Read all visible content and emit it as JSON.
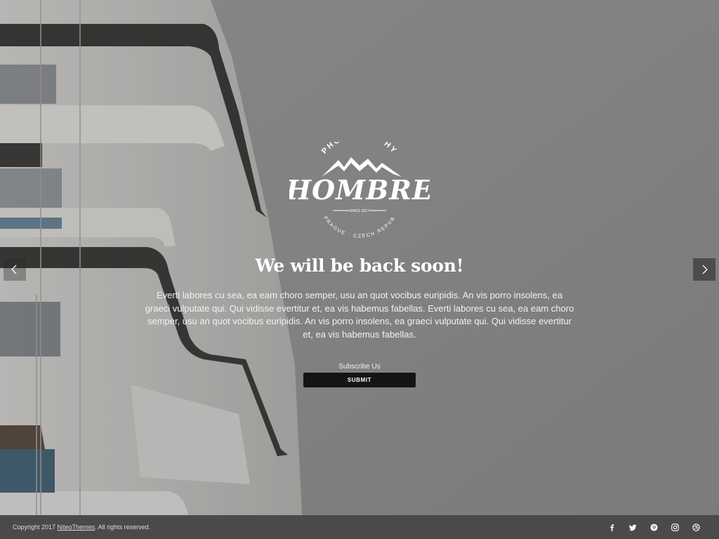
{
  "brand": {
    "top_text": "PHOTOGRAPHY",
    "name": "HOMBRE",
    "since": "SINCE 2017",
    "location": "PRAGUE · CZECH REPUB"
  },
  "hero": {
    "title": "We will be back soon!",
    "description": "Everti labores cu sea, ea eam choro semper, usu an quot vocibus euripidis. An vis porro insolens, ea graeci vulputate qui. Qui vidisse evertitur et, ea vis habemus fabellas. Everti labores cu sea, ea eam choro semper, usu an quot vocibus euripidis. An vis porro insolens, ea graeci vulputate qui. Qui vidisse evertitur et, ea vis habemus fabellas."
  },
  "subscribe": {
    "label": "Subscribe Us",
    "submit_label": "SUBMIT"
  },
  "slider": {
    "prev_icon": "chevron-left-icon",
    "next_icon": "chevron-right-icon"
  },
  "footer": {
    "copyright_prefix": "Copyright 2017 ",
    "copyright_link": "NiteoThemes",
    "copyright_suffix": ". All rights reserved.",
    "social": [
      "facebook-icon",
      "twitter-icon",
      "pinterest-icon",
      "instagram-icon",
      "dribbble-icon"
    ]
  },
  "colors": {
    "button_bg": "#141414",
    "footer_bg": "#4a4a4a",
    "sky": "#9a9a9a"
  }
}
